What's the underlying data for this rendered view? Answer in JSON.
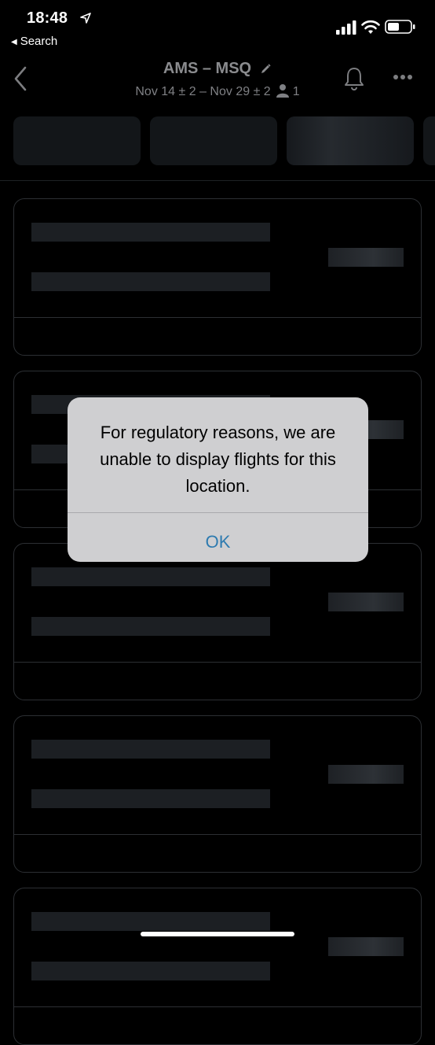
{
  "status_bar": {
    "time": "18:48",
    "back_app": "Search",
    "icons": [
      "location-arrow-icon",
      "signal-icon",
      "wifi-icon",
      "battery-icon"
    ]
  },
  "header": {
    "title": "AMS – MSQ",
    "dates": "Nov 14 ± 2 – Nov 29 ± 2",
    "passengers": "1",
    "icons": [
      "back-chevron-icon",
      "pencil-icon",
      "person-icon",
      "bell-icon",
      "more-icon"
    ]
  },
  "alert": {
    "message": "For regulatory reasons, we are unable to display flights for this location.",
    "ok_label": "OK"
  },
  "colors": {
    "background": "#000000",
    "alert_background": "#cfcfd1",
    "alert_button": "#2e7bb0",
    "skeleton": "#1c1f23"
  }
}
